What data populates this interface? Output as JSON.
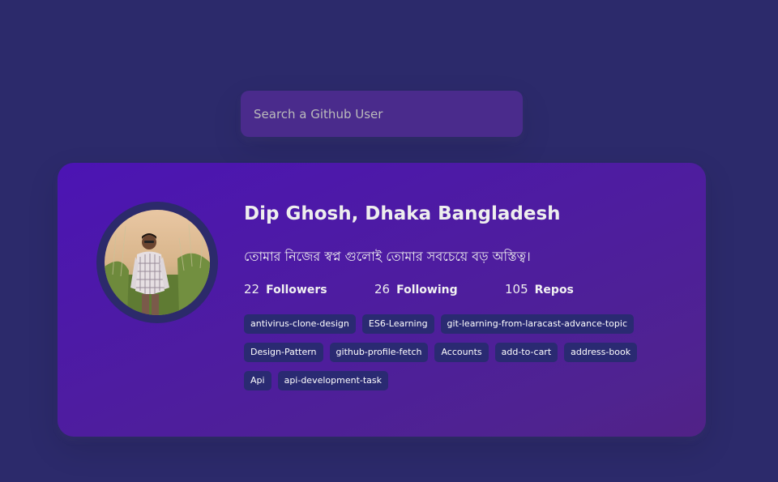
{
  "search": {
    "placeholder": "Search a Github User",
    "value": ""
  },
  "profile": {
    "name": "Dip Ghosh, Dhaka Bangladesh",
    "bio": "তোমার নিজের স্বপ্ন গুলোই তোমার সবচেয়ে বড় অস্তিত্ব।",
    "avatar_icon": "avatar-photo",
    "stats": [
      {
        "count": "22",
        "label": "Followers"
      },
      {
        "count": "26",
        "label": "Following"
      },
      {
        "count": "105",
        "label": "Repos"
      }
    ],
    "repos": [
      "antivirus-clone-design",
      "ES6-Learning",
      "git-learning-from-laracast-advance-topic",
      "Design-Pattern",
      "github-profile-fetch",
      "Accounts",
      "add-to-cart",
      "address-book",
      "Api",
      "api-development-task"
    ]
  },
  "colors": {
    "background": "#2c2a6b",
    "card_gradient_start": "#4c14b4",
    "card_gradient_end": "#512286",
    "input_background": "#4a2b8c",
    "repo_tag_background": "#2a2a72"
  }
}
